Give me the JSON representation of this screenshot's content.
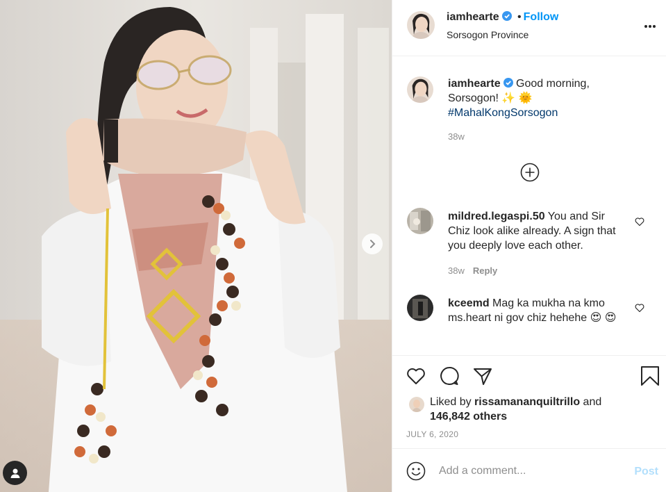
{
  "post": {
    "username": "iamhearte",
    "follow_label": "Follow",
    "location": "Sorsogon Province",
    "caption_text": "Good morning, Sorsogon! ✨ 🌞",
    "hashtag": "#MahalKongSorsogon",
    "caption_time": "38w"
  },
  "comments": [
    {
      "username": "mildred.legaspi.50",
      "text": "You and Sir Chiz look alike already. A sign that you deeply love each other.",
      "time": "38w",
      "reply_label": "Reply"
    },
    {
      "username": "kceemd",
      "text": "Mag ka mukha na kmo ms.heart ni gov chiz hehehe 😍 😍"
    }
  ],
  "likes": {
    "prefix": "Liked by",
    "user": "rissamananquiltrillo",
    "and": "and",
    "count": "146,842 others"
  },
  "date": "JULY 6, 2020",
  "comment_box": {
    "placeholder": "Add a comment...",
    "post_label": "Post"
  },
  "colors": {
    "accent": "#0095f6",
    "post_disabled": "#b2dffc",
    "text": "#262626",
    "muted": "#8e8e8e"
  },
  "icons": [
    "verified-badge-icon",
    "more-options-icon",
    "heart-icon",
    "comment-icon",
    "share-icon",
    "bookmark-icon",
    "emoji-icon",
    "plus-circle-icon",
    "chevron-right-icon",
    "user-tag-icon"
  ]
}
